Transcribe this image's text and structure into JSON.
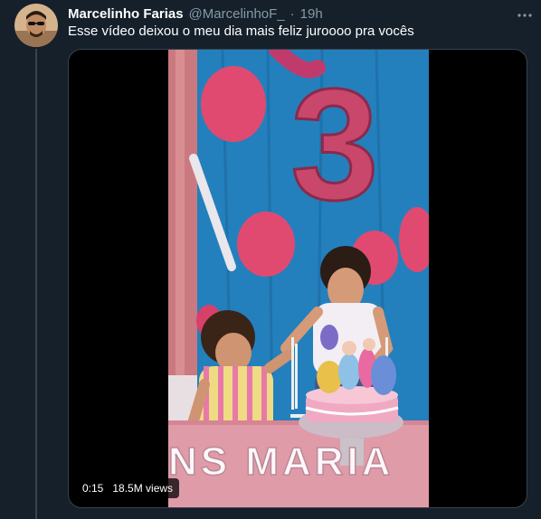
{
  "tweet": {
    "author_name": "Marcelinho Farias",
    "handle": "@MarcelinhoF_",
    "separator": "·",
    "time": "19h",
    "more_icon": "more-dots-icon",
    "text": "Esse vídeo deixou o meu dia mais feliz juroooo pra vocês"
  },
  "video": {
    "elapsed": "0:15",
    "views": "18.5M views",
    "big_number": "3",
    "banner_text": "NS MARIA"
  },
  "colors": {
    "background": "#15202b",
    "text_secondary": "#8899a6",
    "border": "#38444d"
  }
}
